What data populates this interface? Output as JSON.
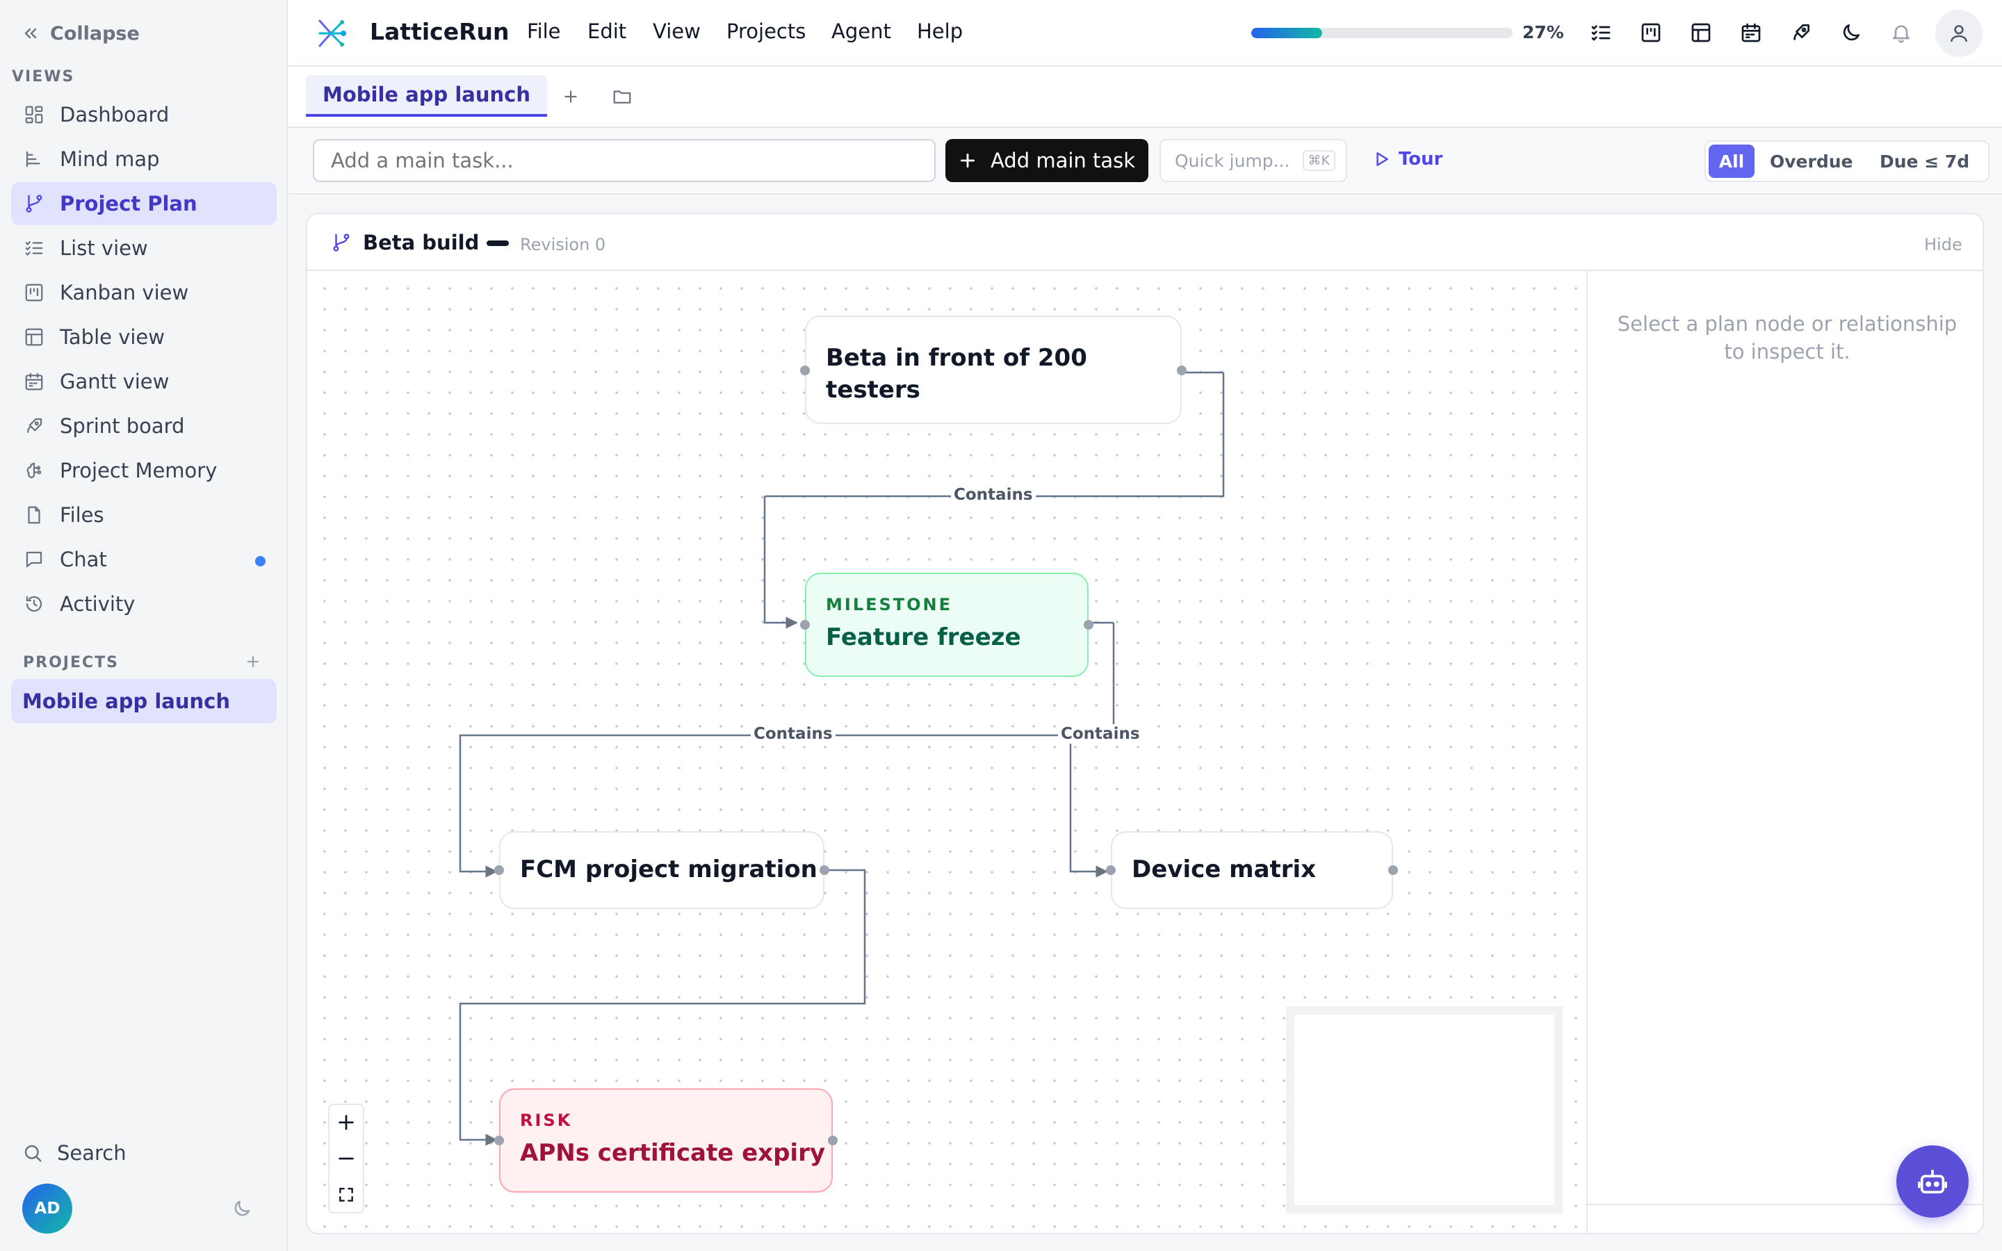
{
  "sidebar": {
    "collapse_label": "Collapse",
    "views_label": "VIEWS",
    "items": [
      {
        "label": "Dashboard",
        "icon": "dashboard-icon"
      },
      {
        "label": "Mind map",
        "icon": "mind-map-icon"
      },
      {
        "label": "Project Plan",
        "icon": "branch-icon",
        "active": true
      },
      {
        "label": "List view",
        "icon": "list-icon"
      },
      {
        "label": "Kanban view",
        "icon": "kanban-icon"
      },
      {
        "label": "Table view",
        "icon": "table-icon"
      },
      {
        "label": "Gantt view",
        "icon": "calendar-icon"
      },
      {
        "label": "Sprint board",
        "icon": "rocket-icon"
      },
      {
        "label": "Project Memory",
        "icon": "brain-icon"
      },
      {
        "label": "Files",
        "icon": "file-icon"
      },
      {
        "label": "Chat",
        "icon": "chat-icon",
        "unread": true
      },
      {
        "label": "Activity",
        "icon": "history-icon"
      }
    ],
    "projects_label": "PROJECTS",
    "projects": [
      {
        "label": "Mobile app launch"
      }
    ],
    "search_label": "Search",
    "avatar_initials": "AD"
  },
  "topbar": {
    "app_name": "LatticeRun",
    "menu": [
      "File",
      "Edit",
      "View",
      "Projects",
      "Agent",
      "Help"
    ],
    "progress_percent": 27,
    "progress_label": "27%"
  },
  "tabs": [
    {
      "label": "Mobile app launch",
      "active": true
    }
  ],
  "toolbar": {
    "task_placeholder": "Add a main task...",
    "add_button_label": "Add main task",
    "quick_jump_label": "Quick jump...",
    "quick_jump_shortcut": "⌘K",
    "tour_label": "Tour",
    "filters": [
      "All",
      "Overdue",
      "Due ≤ 7d"
    ],
    "active_filter": "All"
  },
  "plan": {
    "title": "Beta build",
    "revision": "Revision 0",
    "hide_label": "Hide",
    "inspector_hint": "Select a plan node or relationship to inspect it.",
    "nodes": [
      {
        "id": "goal",
        "kind": "",
        "title": "Beta in front of 200 testers"
      },
      {
        "id": "freeze",
        "kind": "MILESTONE",
        "title": "Feature freeze"
      },
      {
        "id": "fcm",
        "kind": "",
        "title": "FCM project migration"
      },
      {
        "id": "device",
        "kind": "",
        "title": "Device matrix"
      },
      {
        "id": "apns",
        "kind": "RISK",
        "title": "APNs certificate expiry"
      }
    ],
    "edges": [
      {
        "from": "goal",
        "to": "freeze",
        "label": "Contains"
      },
      {
        "from": "freeze",
        "to": "fcm",
        "label": "Contains"
      },
      {
        "from": "freeze",
        "to": "device",
        "label": "Contains"
      },
      {
        "from": "fcm",
        "to": "apns",
        "label": ""
      }
    ],
    "colors": {
      "milestone": "#15803d",
      "risk": "#be123c",
      "accent": "#4f46e5"
    }
  }
}
